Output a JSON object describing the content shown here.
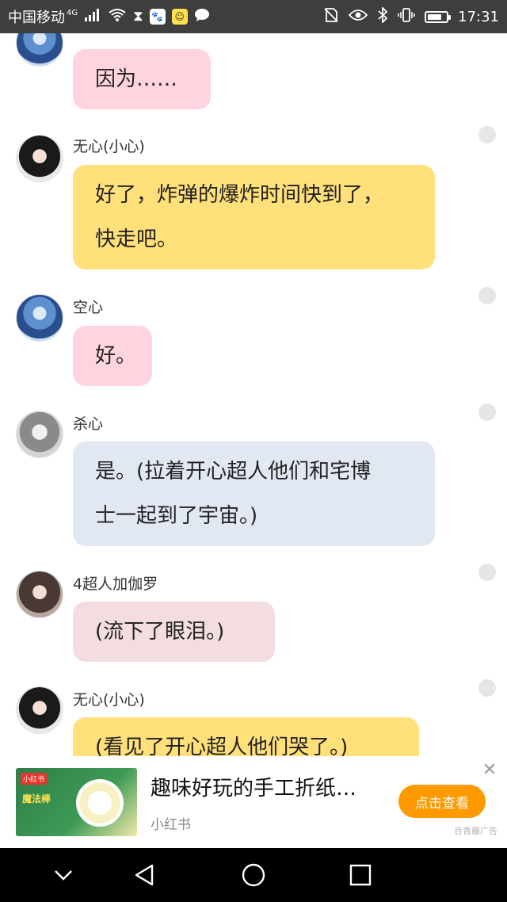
{
  "status_bar": {
    "carrier": "中国移动",
    "network": "4G",
    "time": "17:31",
    "icons_left": [
      "signal-icon",
      "wifi-icon",
      "hourglass-icon",
      "baidu-app-icon",
      "qq-app-icon",
      "message-bubble-icon"
    ],
    "icons_right": [
      "no-sim-icon",
      "eye-icon",
      "bluetooth-icon",
      "vibrate-icon",
      "battery-icon"
    ],
    "battery_level": 0.75
  },
  "messages": [
    {
      "sender": "",
      "text_lines": [
        "因为……"
      ],
      "color": "pink"
    },
    {
      "sender": "无心(小心)",
      "text_lines": [
        "好了，炸弹的爆炸时间快到了，",
        "快走吧。"
      ],
      "color": "yellow"
    },
    {
      "sender": "空心",
      "text_lines": [
        "好。"
      ],
      "color": "pink"
    },
    {
      "sender": "杀心",
      "text_lines": [
        "是。(拉着开心超人他们和宅博",
        "士一起到了宇宙。)"
      ],
      "color": "blue"
    },
    {
      "sender": "4超人加伽罗",
      "text_lines": [
        "(流下了眼泪。)"
      ],
      "color": "rose"
    },
    {
      "sender": "无心(小心)",
      "text_lines": [
        "(看见了开心超人他们哭了。)"
      ],
      "color": "yellow"
    }
  ],
  "ad": {
    "thumb_tag": "小红书",
    "thumb_title": "魔法棒",
    "title": "趣味好玩的手工折纸…",
    "source": "小红书",
    "button_label": "点击查看",
    "label": "百青藤广告",
    "close_symbol": "✕"
  },
  "navbar": {
    "buttons": [
      "collapse-icon",
      "back-icon",
      "home-icon",
      "recents-icon"
    ]
  }
}
